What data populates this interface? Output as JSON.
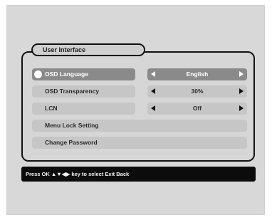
{
  "dialog": {
    "title": "User Interface"
  },
  "menu": [
    {
      "label": "OSD Language",
      "value": "English",
      "selected": true
    },
    {
      "label": "OSD Transparency",
      "value": "30%",
      "selected": false
    },
    {
      "label": "LCN",
      "value": "Off",
      "selected": false
    }
  ],
  "actions": [
    {
      "label": "Menu Lock Setting"
    },
    {
      "label": "Change Password"
    }
  ],
  "help": {
    "text": "Press OK ▲▼◀▶ key to select  Exit Back"
  }
}
